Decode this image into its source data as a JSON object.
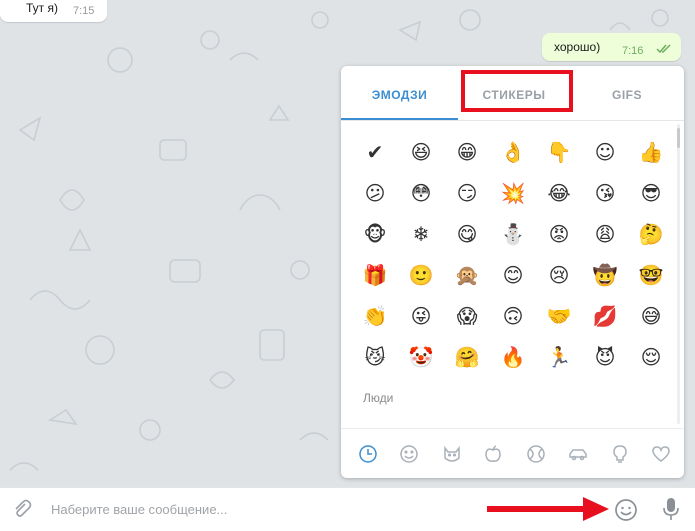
{
  "messages": {
    "incoming": {
      "text": "Тут я)",
      "time": "7:15"
    },
    "outgoing": {
      "text": "хорошо)",
      "time": "7:16",
      "status_icon": "double-check-icon"
    }
  },
  "emoji_panel": {
    "tabs": [
      "ЭМОДЗИ",
      "СТИКЕРЫ",
      "GIFS"
    ],
    "active_tab": "ЭМОДЗИ",
    "emojis": [
      "✔",
      "😆",
      "😁",
      "👌",
      "👇",
      "☺",
      "👍",
      "😕",
      "😳",
      "😏",
      "💥",
      "😂",
      "😘",
      "😎",
      "🐵",
      "❄",
      "😋",
      "⛄",
      "😡",
      "😩",
      "🤔",
      "🎁",
      "🙂",
      "🙊",
      "😊",
      "😢",
      "🤠",
      "🤓",
      "👏",
      "😜",
      "😱",
      "🙃",
      "🤝",
      "💋",
      "😅",
      "😼",
      "🤡",
      "🤗",
      "🔥",
      "🏃",
      "😈",
      "😌"
    ],
    "section_label": "Люди",
    "categories": [
      "clock-icon",
      "smile-icon",
      "cat-icon",
      "apple-icon",
      "ball-icon",
      "car-icon",
      "bulb-icon",
      "heart-icon"
    ],
    "active_category": "clock-icon"
  },
  "composer": {
    "placeholder": "Наберите ваше сообщение..."
  },
  "accent_color": "#3a8ed1",
  "highlight_color": "#e8101e"
}
